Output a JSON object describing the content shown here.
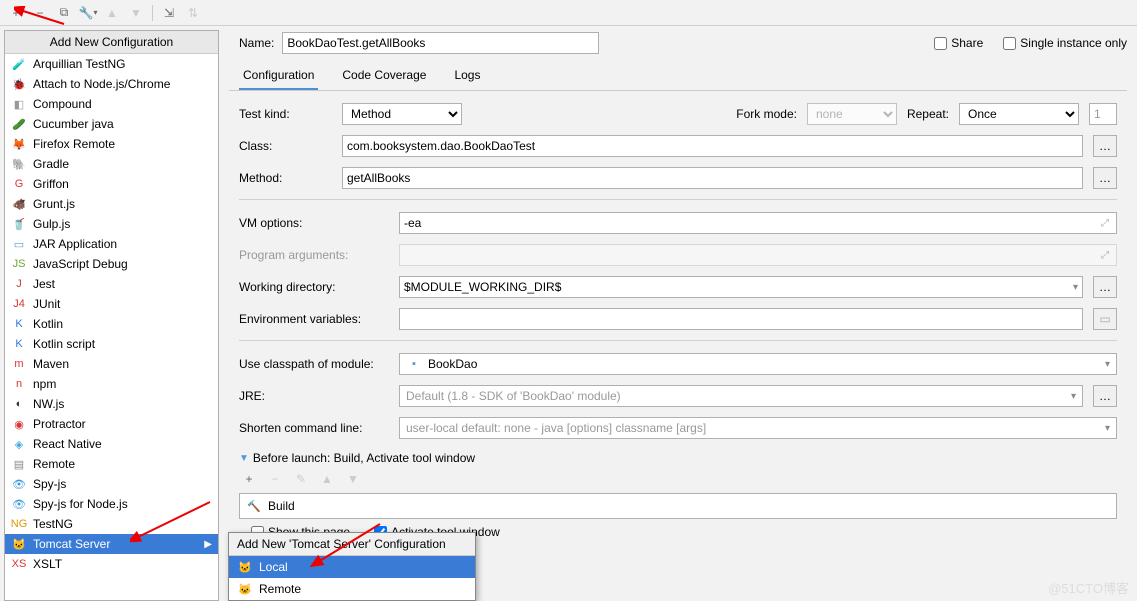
{
  "toolbar_icons": [
    "+",
    "−",
    "⧉",
    "🔧",
    "▾",
    "↶",
    "↷",
    "⇆"
  ],
  "sidebar": {
    "header": "Add New Configuration",
    "items": [
      {
        "icon": "🧪",
        "color": "#d33",
        "label": "Arquillian TestNG"
      },
      {
        "icon": "🐞",
        "color": "#090",
        "label": "Attach to Node.js/Chrome"
      },
      {
        "icon": "◧",
        "color": "#999",
        "label": "Compound"
      },
      {
        "icon": "🥒",
        "color": "#3a3",
        "label": "Cucumber java"
      },
      {
        "icon": "🦊",
        "color": "#e60",
        "label": "Firefox Remote"
      },
      {
        "icon": "🐘",
        "color": "#888",
        "label": "Gradle"
      },
      {
        "icon": "G",
        "color": "#d33",
        "label": "Griffon"
      },
      {
        "icon": "🐗",
        "color": "#c90",
        "label": "Grunt.js"
      },
      {
        "icon": "🥤",
        "color": "#d33",
        "label": "Gulp.js"
      },
      {
        "icon": "▭",
        "color": "#59d",
        "label": "JAR Application"
      },
      {
        "icon": "JS",
        "color": "#6a3",
        "label": "JavaScript Debug"
      },
      {
        "icon": "J",
        "color": "#b44",
        "label": "Jest"
      },
      {
        "icon": "J4",
        "color": "#d33",
        "label": "JUnit"
      },
      {
        "icon": "K",
        "color": "#37d",
        "label": "Kotlin"
      },
      {
        "icon": "K",
        "color": "#37d",
        "label": "Kotlin script"
      },
      {
        "icon": "m",
        "color": "#d33",
        "label": "Maven"
      },
      {
        "icon": "n",
        "color": "#d33",
        "label": "npm"
      },
      {
        "icon": "◐",
        "color": "#333",
        "label": "NW.js"
      },
      {
        "icon": "◉",
        "color": "#d33",
        "label": "Protractor"
      },
      {
        "icon": "◈",
        "color": "#4ad",
        "label": "React Native"
      },
      {
        "icon": "▤",
        "color": "#888",
        "label": "Remote"
      },
      {
        "icon": "👁",
        "color": "#39d",
        "label": "Spy-js"
      },
      {
        "icon": "👁",
        "color": "#39d",
        "label": "Spy-js for Node.js"
      },
      {
        "icon": "NG",
        "color": "#d90",
        "label": "TestNG"
      },
      {
        "icon": "🐱",
        "color": "#ca3",
        "label": "Tomcat Server",
        "selected": true,
        "submenu": true
      },
      {
        "icon": "XS",
        "color": "#d33",
        "label": "XSLT"
      }
    ]
  },
  "submenu": {
    "header": "Add New 'Tomcat Server' Configuration",
    "items": [
      {
        "icon": "🐱",
        "label": "Local",
        "selected": true
      },
      {
        "icon": "🐱",
        "label": "Remote"
      }
    ]
  },
  "name_label": "Name:",
  "name_value": "BookDaoTest.getAllBooks",
  "share_label": "Share",
  "single_instance_label": "Single instance only",
  "tabs": [
    {
      "label": "Configuration",
      "active": true
    },
    {
      "label": "Code Coverage"
    },
    {
      "label": "Logs"
    }
  ],
  "config": {
    "test_kind_label": "Test kind:",
    "test_kind_value": "Method",
    "fork_mode_label": "Fork mode:",
    "fork_mode_value": "none",
    "repeat_label": "Repeat:",
    "repeat_value": "Once",
    "repeat_count": "1",
    "class_label": "Class:",
    "class_value": "com.booksystem.dao.BookDaoTest",
    "method_label": "Method:",
    "method_value": "getAllBooks",
    "vm_label": "VM options:",
    "vm_value": "-ea",
    "prog_args_label": "Program arguments:",
    "workdir_label": "Working directory:",
    "workdir_value": "$MODULE_WORKING_DIR$",
    "env_label": "Environment variables:",
    "classpath_label": "Use classpath of module:",
    "classpath_value": "BookDao",
    "jre_label": "JRE:",
    "jre_value": "Default (1.8 - SDK of 'BookDao' module)",
    "shorten_label": "Shorten command line:",
    "shorten_value": "user-local default: none - java [options] classname [args]"
  },
  "before_launch": {
    "header": "Before launch: Build, Activate tool window",
    "build_label": "Build",
    "show_page_label": "Show this page",
    "activate_label": "Activate tool window"
  },
  "watermark": "@51CTO博客"
}
